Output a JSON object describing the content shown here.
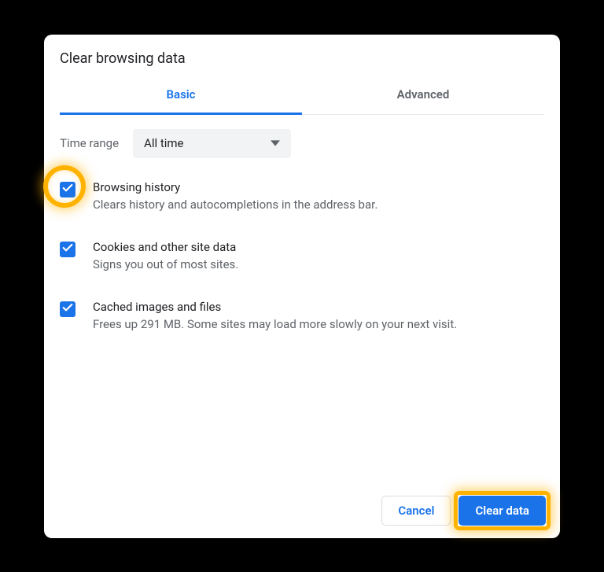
{
  "title": "Clear browsing data",
  "tabs": {
    "basic": "Basic",
    "advanced": "Advanced"
  },
  "timeRange": {
    "label": "Time range",
    "value": "All time"
  },
  "options": [
    {
      "title": "Browsing history",
      "desc": "Clears history and autocompletions in the address bar.",
      "highlight": true
    },
    {
      "title": "Cookies and other site data",
      "desc": "Signs you out of most sites."
    },
    {
      "title": "Cached images and files",
      "desc": "Frees up 291 MB. Some sites may load more slowly on your next visit."
    }
  ],
  "footer": {
    "cancel": "Cancel",
    "clear": "Clear data"
  }
}
